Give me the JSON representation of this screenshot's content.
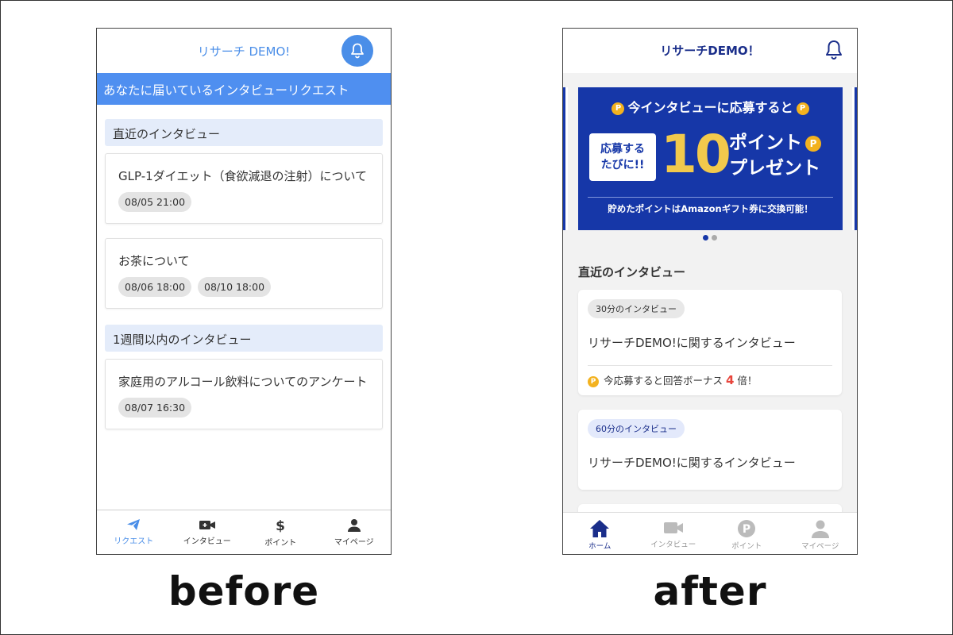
{
  "before": {
    "caption": "before",
    "header_title": "リサーチ DEMO!",
    "banner": "あなたに届いているインタビューリクエスト",
    "sections": [
      {
        "title": "直近のインタビュー",
        "cards": [
          {
            "title": "GLP-1ダイエット（食欲減退の注射）について",
            "dates": [
              "08/05 21:00"
            ]
          },
          {
            "title": "お茶について",
            "dates": [
              "08/06 18:00",
              "08/10 18:00"
            ]
          }
        ]
      },
      {
        "title": "1週間以内のインタビュー",
        "cards": [
          {
            "title": "家庭用のアルコール飲料についてのアンケート",
            "dates": [
              "08/07 16:30"
            ]
          }
        ]
      }
    ],
    "tabs": [
      "リクエスト",
      "インタビュー",
      "ポイント",
      "マイページ"
    ],
    "accent": "#4a8ee8"
  },
  "after": {
    "caption": "after",
    "header_title": "リサーチDEMO！",
    "promo": {
      "headline": "今インタビューに応募すると",
      "badge_line1": "応募する",
      "badge_line2": "たびに!!",
      "number": "10",
      "word1": "ポイント",
      "word2": "プレゼント",
      "coin": "P",
      "footer": "貯めたポイントはAmazonギフト券に交換可能！"
    },
    "section_title": "直近のインタビュー",
    "cards": [
      {
        "duration": "30分のインタビュー",
        "title": "リサーチDEMO!に関するインタビュー",
        "bonus_pre": "今応募すると回答ボーナス",
        "bonus_mult": "4",
        "bonus_post": "倍！"
      },
      {
        "duration": "60分のインタビュー",
        "title": "リサーチDEMO!に関するインタビュー"
      }
    ],
    "tabs": [
      "ホーム",
      "インタビュー",
      "ポイント",
      "マイページ"
    ],
    "accent": "#1637a8"
  }
}
